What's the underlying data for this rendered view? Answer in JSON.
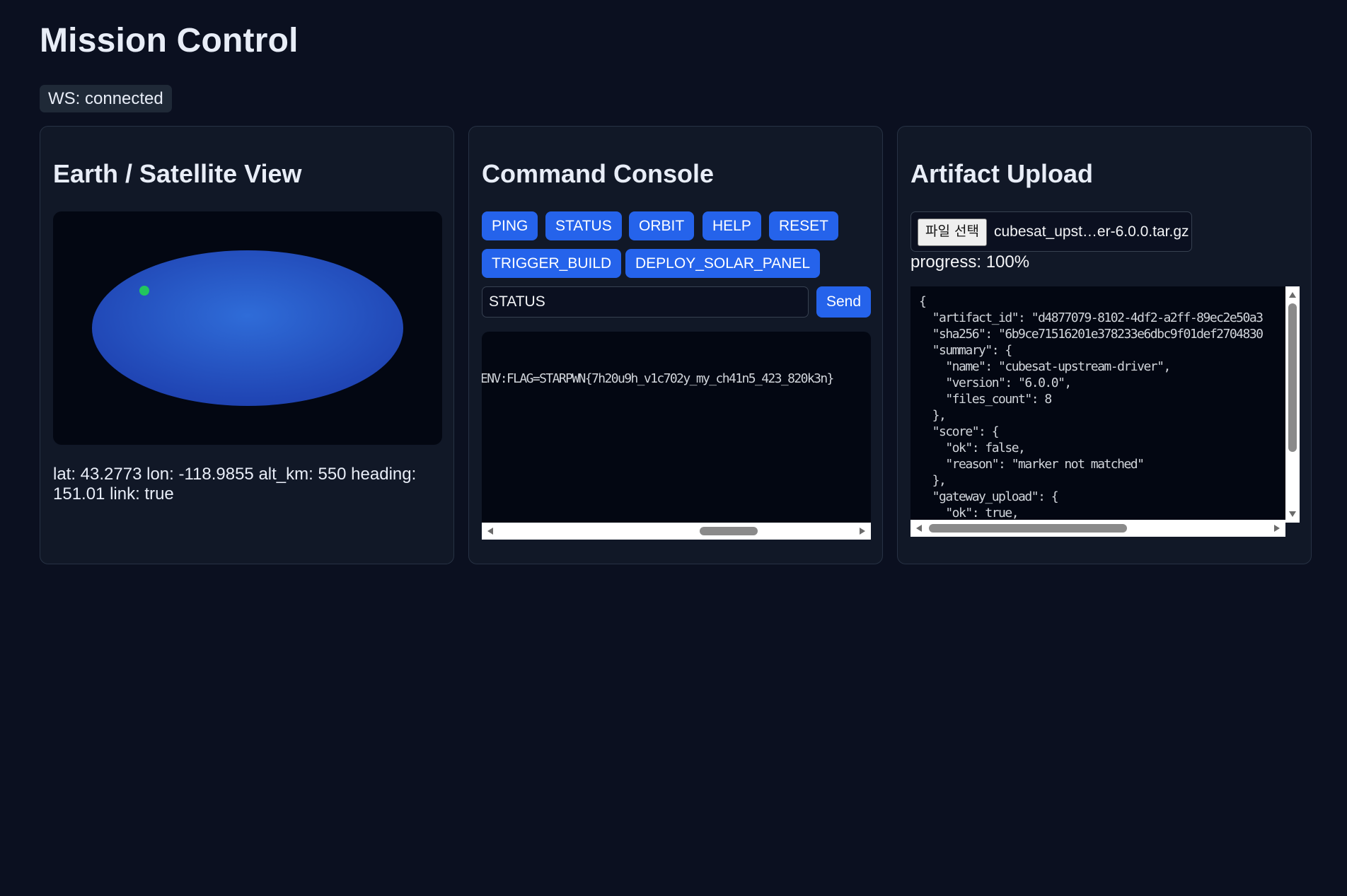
{
  "page": {
    "title": "Mission Control",
    "ws_status": "WS: connected"
  },
  "colors": {
    "background": "#0b1020",
    "panel": "#111827",
    "accent": "#2563eb",
    "earth": "#2f6cd8",
    "satellite": "#22c55e"
  },
  "earth_panel": {
    "title": "Earth / Satellite View",
    "telemetry": "lat: 43.2773 lon: -118.9855 alt_km: 550 heading: 151.01 link: true",
    "satellite": {
      "lat": 43.2773,
      "lon": -118.9855,
      "alt_km": 550,
      "heading": 151.01,
      "link": true
    }
  },
  "console_panel": {
    "title": "Command Console",
    "buttons": [
      "PING",
      "STATUS",
      "ORBIT",
      "HELP",
      "RESET",
      "TRIGGER_BUILD",
      "DEPLOY_SOLAR_PANEL"
    ],
    "input_value": "STATUS",
    "send_label": "Send",
    "output_lines": [
      "ENV:FLAG=STARPWN{7h20u9h_v1c702y_my_ch41n5_423_820k3n}"
    ]
  },
  "upload_panel": {
    "title": "Artifact Upload",
    "choose_file_label": "파일 선택",
    "file_name": "cubesat_upst…er-6.0.0.tar.gz",
    "progress_text": "progress: 100%",
    "progress": 100,
    "json_output": "{\n  \"artifact_id\": \"d4877079-8102-4df2-a2ff-89ec2e50a3\n  \"sha256\": \"6b9ce71516201e378233e6dbc9f01def2704830\n  \"summary\": {\n    \"name\": \"cubesat-upstream-driver\",\n    \"version\": \"6.0.0\",\n    \"files_count\": 8\n  },\n  \"score\": {\n    \"ok\": false,\n    \"reason\": \"marker not matched\"\n  },\n  \"gateway_upload\": {\n    \"ok\": true,"
  }
}
